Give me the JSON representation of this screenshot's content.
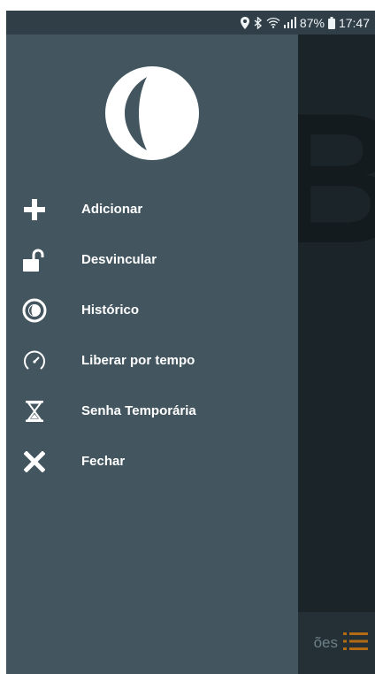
{
  "status_bar": {
    "battery": "87%",
    "time": "17:47",
    "icons": [
      "location-icon",
      "bluetooth-icon",
      "wifi-icon",
      "signal-icon",
      "battery-icon"
    ]
  },
  "background": {
    "bottom_label": "ões"
  },
  "drawer": {
    "logo": "half-moon-logo-icon",
    "items": [
      {
        "label": "Adicionar",
        "icon": "plus-icon"
      },
      {
        "label": "Desvincular",
        "icon": "unlocked-padlock-icon"
      },
      {
        "label": "Histórico",
        "icon": "history-eye-icon"
      },
      {
        "label": "Liberar por tempo",
        "icon": "speedometer-icon"
      },
      {
        "label": "Senha Temporária",
        "icon": "hourglass-icon"
      },
      {
        "label": "Fechar",
        "icon": "close-icon"
      }
    ]
  },
  "colors": {
    "drawer_bg": "#435660",
    "status_bar_bg": "#2f3e47",
    "accent": "#b36b14"
  }
}
